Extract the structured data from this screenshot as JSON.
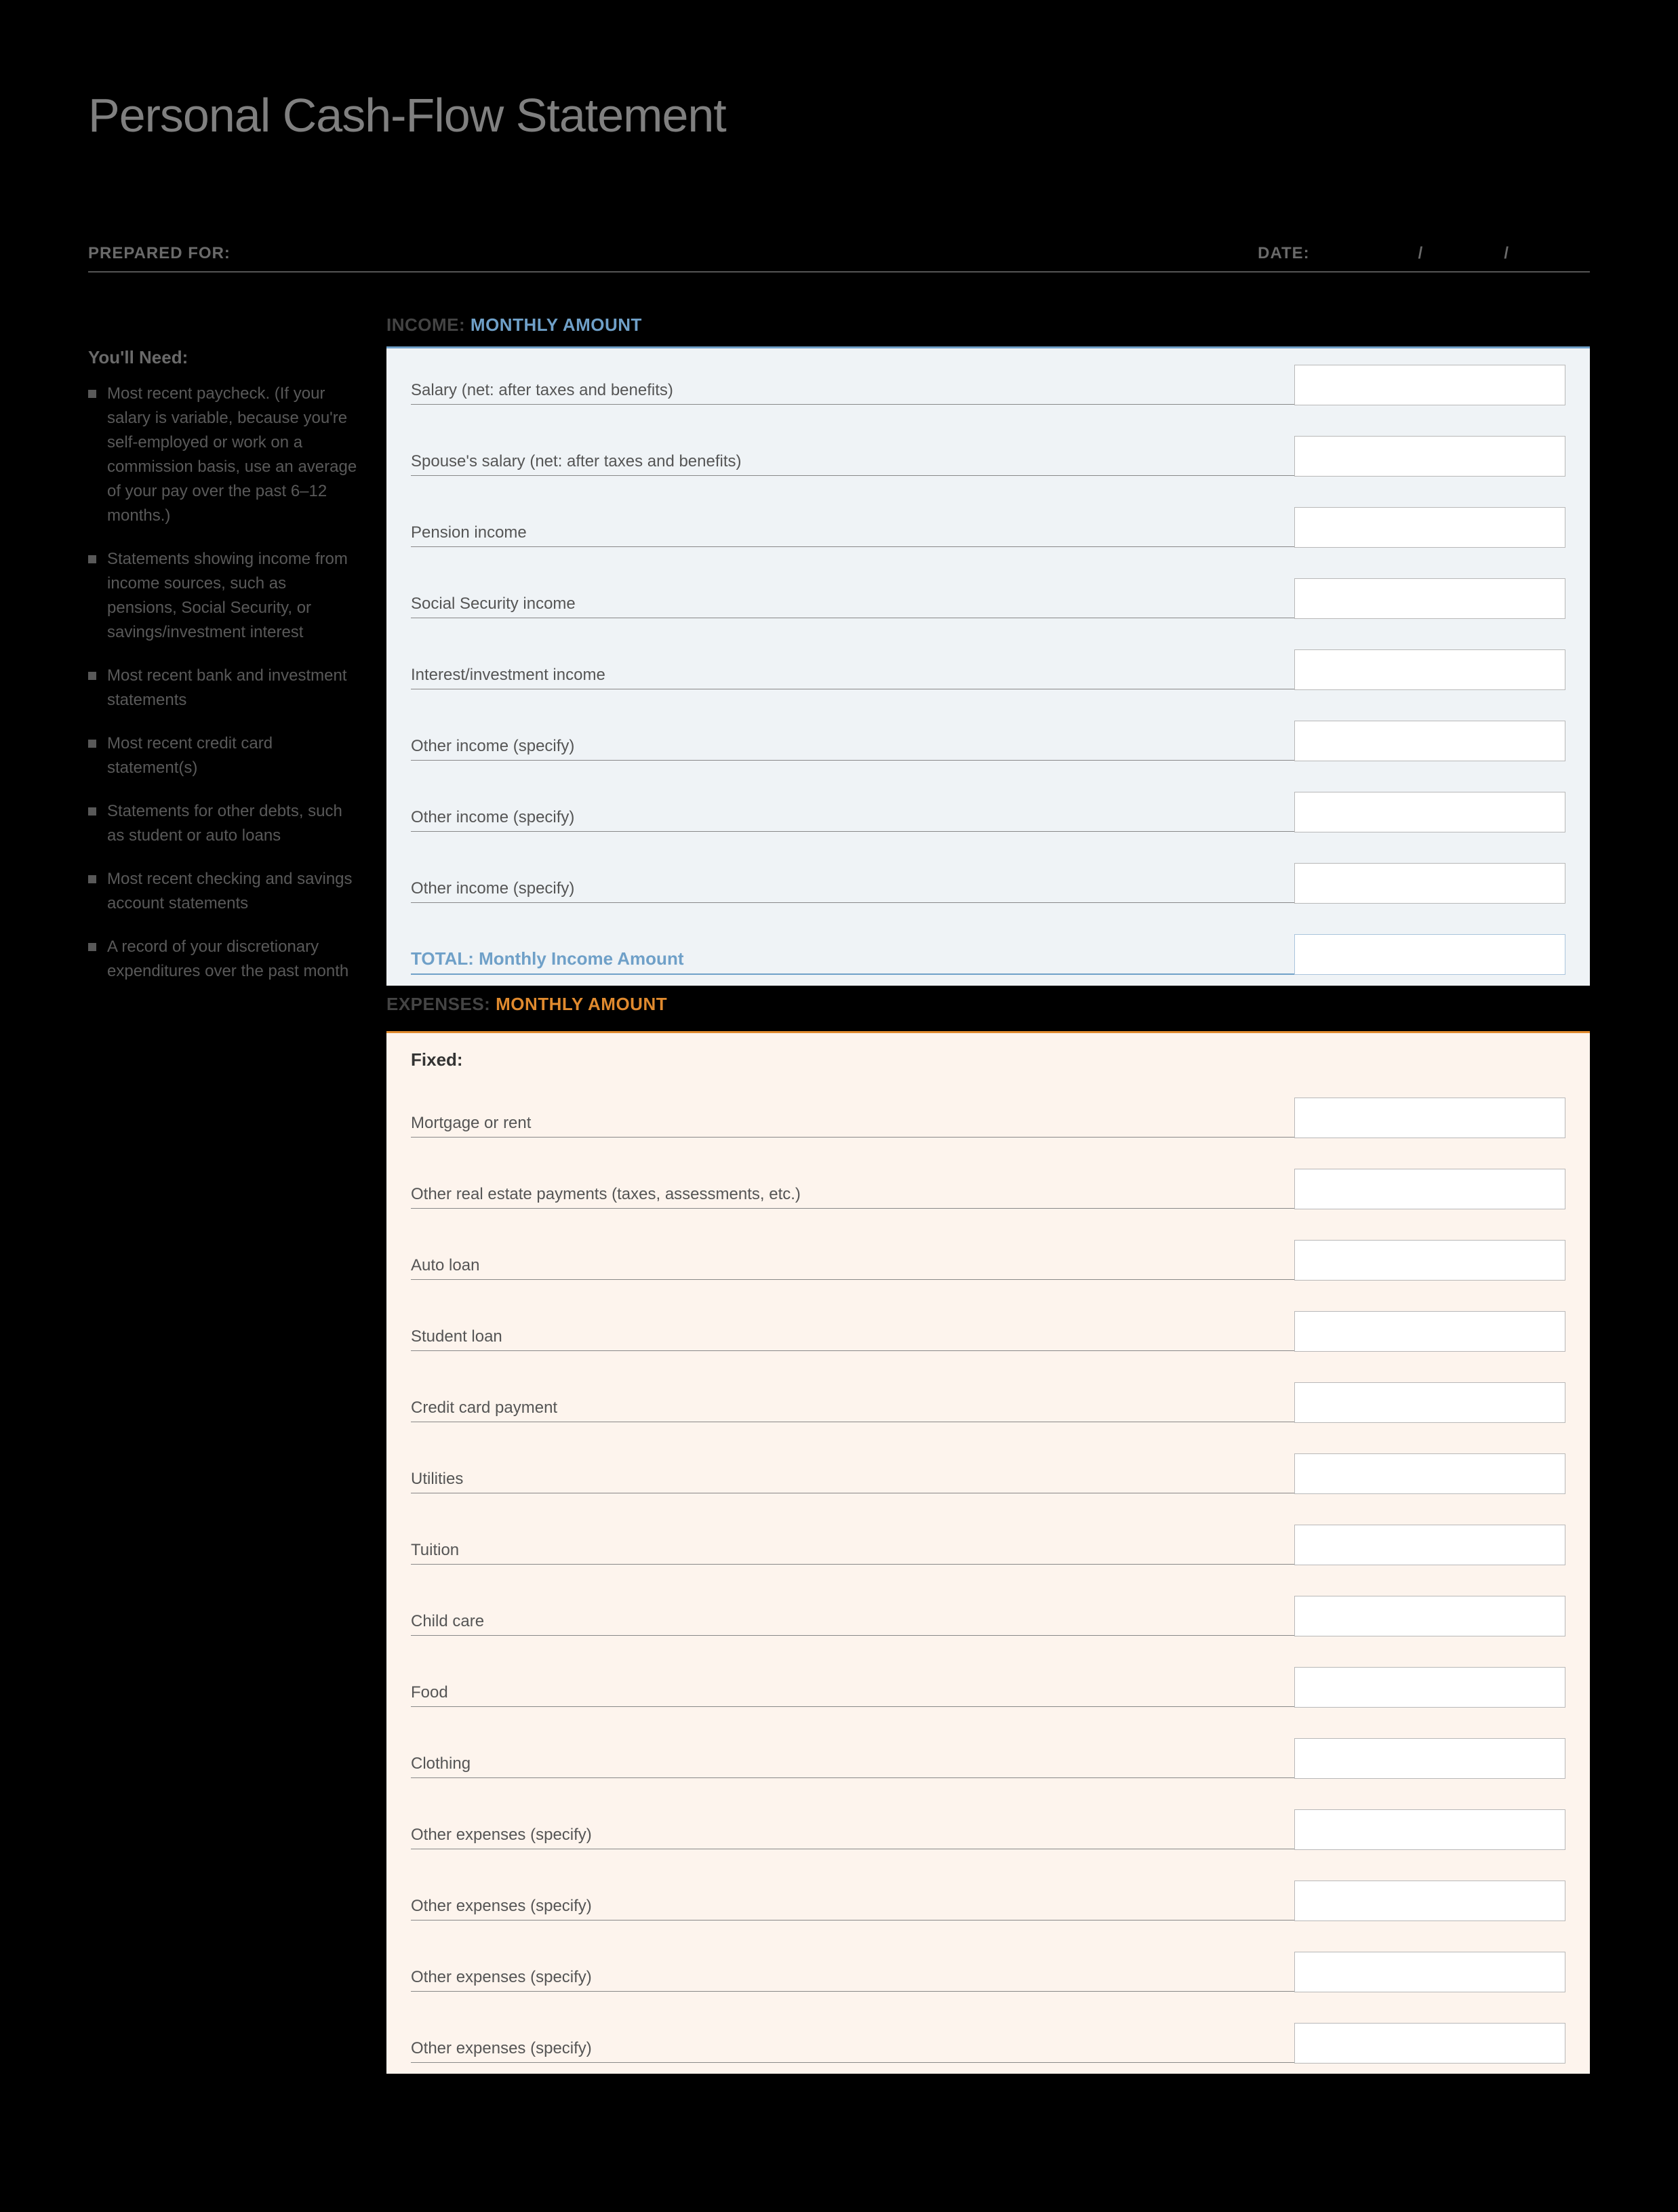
{
  "title": "Personal Cash-Flow Statement",
  "header": {
    "prepared_for_label": "PREPARED FOR:",
    "date_label": "DATE:",
    "slash": "/"
  },
  "sidebar": {
    "title": "You'll Need:",
    "items": [
      "Most recent paycheck. (If your salary is variable, because you're self-employed or work on a commission basis, use an average of your pay over the past 6–12 months.)",
      "Statements showing income from income sources, such as pensions, Social Security, or savings/investment interest",
      "Most recent bank and investment statements",
      "Most recent credit card statement(s)",
      "Statements for other debts, such as student or auto loans",
      "Most recent checking and savings account statements",
      "A record of your discretionary expenditures over the past month"
    ]
  },
  "income": {
    "header_label": "INCOME:",
    "header_sub": "MONTHLY AMOUNT",
    "rows": [
      "Salary (net: after taxes and benefits)",
      "Spouse's salary (net: after taxes and benefits)",
      "Pension income",
      "Social Security income",
      "Interest/investment income",
      "Other income (specify)",
      "Other income (specify)",
      "Other income (specify)"
    ],
    "total_label": "TOTAL: Monthly Income Amount"
  },
  "expenses": {
    "header_label": "EXPENSES:",
    "header_sub": "MONTHLY AMOUNT",
    "fixed_label": "Fixed:",
    "rows": [
      "Mortgage or rent",
      "Other real estate payments (taxes, assessments, etc.)",
      "Auto loan",
      "Student loan",
      "Credit card payment",
      "Utilities",
      "Tuition",
      "Child care",
      "Food",
      "Clothing",
      "Other expenses (specify)",
      "Other expenses (specify)",
      "Other expenses (specify)",
      "Other expenses (specify)"
    ]
  }
}
